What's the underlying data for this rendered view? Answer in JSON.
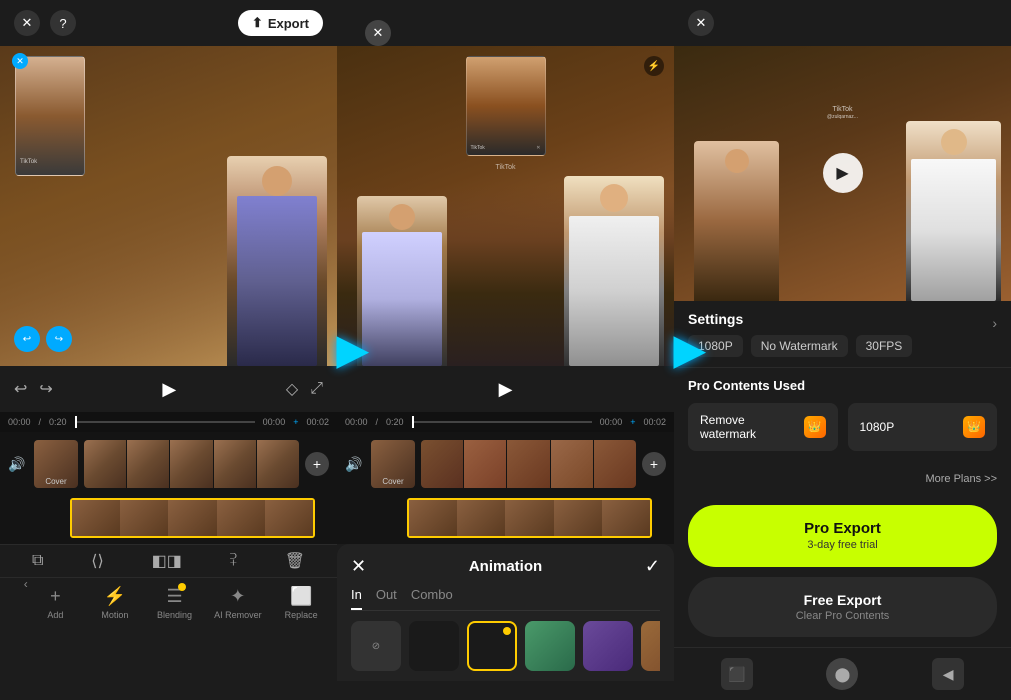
{
  "panel1": {
    "export_label": "Export",
    "time_current": "00:00",
    "time_total": "0:20",
    "time_marker1": "00:00",
    "time_marker2": "00:02",
    "cover_label": "Cover",
    "tools": [
      {
        "id": "split",
        "label": "",
        "symbol": "⊟"
      },
      {
        "id": "speed",
        "label": "",
        "symbol": "⟨⟩"
      },
      {
        "id": "trim",
        "label": "",
        "symbol": "◧◨"
      },
      {
        "id": "delete",
        "label": "",
        "symbol": "🗑"
      }
    ],
    "nav_items": [
      {
        "id": "add",
        "label": "Add",
        "icon": "+"
      },
      {
        "id": "motion",
        "label": "Motion",
        "icon": "⚡"
      },
      {
        "id": "blending",
        "label": "Blending",
        "icon": "☰"
      },
      {
        "id": "ai-remover",
        "label": "AI Remover",
        "icon": "✦"
      },
      {
        "id": "replace",
        "label": "Replace",
        "icon": "⬜"
      }
    ]
  },
  "panel2": {
    "animation_title": "Animation",
    "tabs": [
      {
        "id": "in",
        "label": "In",
        "active": true
      },
      {
        "id": "out",
        "label": "Out",
        "active": false
      },
      {
        "id": "combo",
        "label": "Combo",
        "active": false
      }
    ],
    "anim_items": [
      {
        "id": "none",
        "label": "None",
        "type": "none"
      },
      {
        "id": "fade",
        "label": "",
        "type": "dark"
      },
      {
        "id": "slide",
        "label": "",
        "type": "dark",
        "selected": true
      },
      {
        "id": "zoom",
        "label": "",
        "type": "beach"
      },
      {
        "id": "spin",
        "label": "",
        "type": "city"
      },
      {
        "id": "blur",
        "label": "",
        "type": "warm"
      }
    ],
    "time_current": "00:00",
    "time_total": "0:20"
  },
  "panel3": {
    "settings_title": "Settings",
    "settings_tags": [
      "1080P",
      "No Watermark",
      "30FPS"
    ],
    "pro_contents_title": "Pro Contents Used",
    "pro_card1_label": "Remove watermark",
    "pro_card2_label": "1080P",
    "more_plans_label": "More Plans >>",
    "pro_export_label": "Pro Export",
    "pro_export_sub": "3-day free trial",
    "free_export_label": "Free Export",
    "free_export_sub": "Clear Pro Contents"
  },
  "arrows": {
    "arrow_symbol": "▶"
  }
}
